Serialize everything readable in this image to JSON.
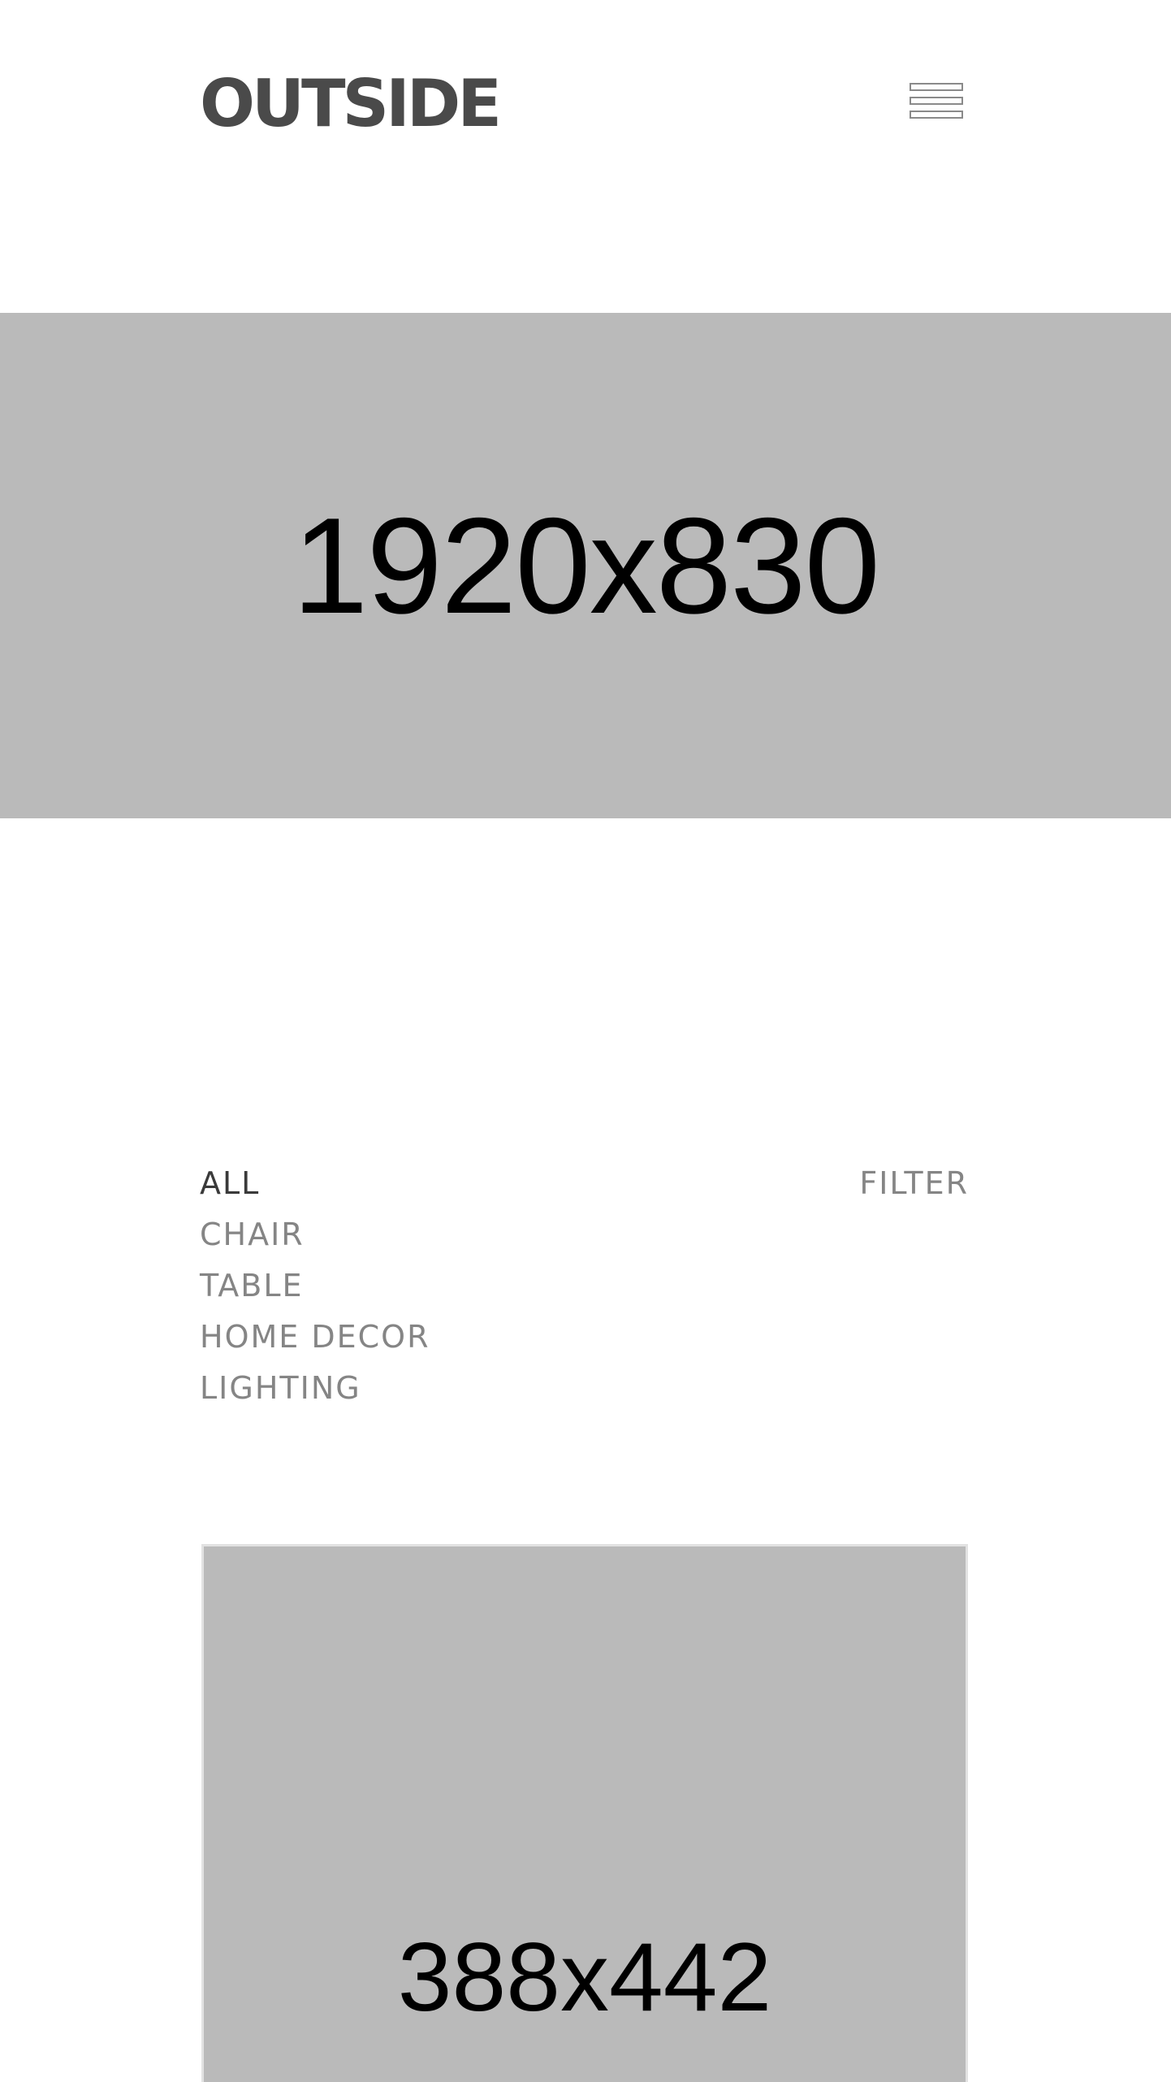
{
  "header": {
    "logo_text": "OUTSIDE",
    "menu_icon": "hamburger-menu-icon"
  },
  "hero": {
    "placeholder_label": "1920x830"
  },
  "filters": {
    "categories": [
      {
        "label": "ALL",
        "active": true
      },
      {
        "label": "CHAIR",
        "active": false
      },
      {
        "label": "TABLE",
        "active": false
      },
      {
        "label": "HOME DECOR",
        "active": false
      },
      {
        "label": "LIGHTING",
        "active": false
      }
    ],
    "filter_label": "FILTER"
  },
  "products": [
    {
      "placeholder_label": "388x442"
    }
  ],
  "colors": {
    "placeholder_bg": "#bababa",
    "logo": "#4a4a4a",
    "filter_inactive": "#858585",
    "filter_active": "#3a3a3a"
  }
}
